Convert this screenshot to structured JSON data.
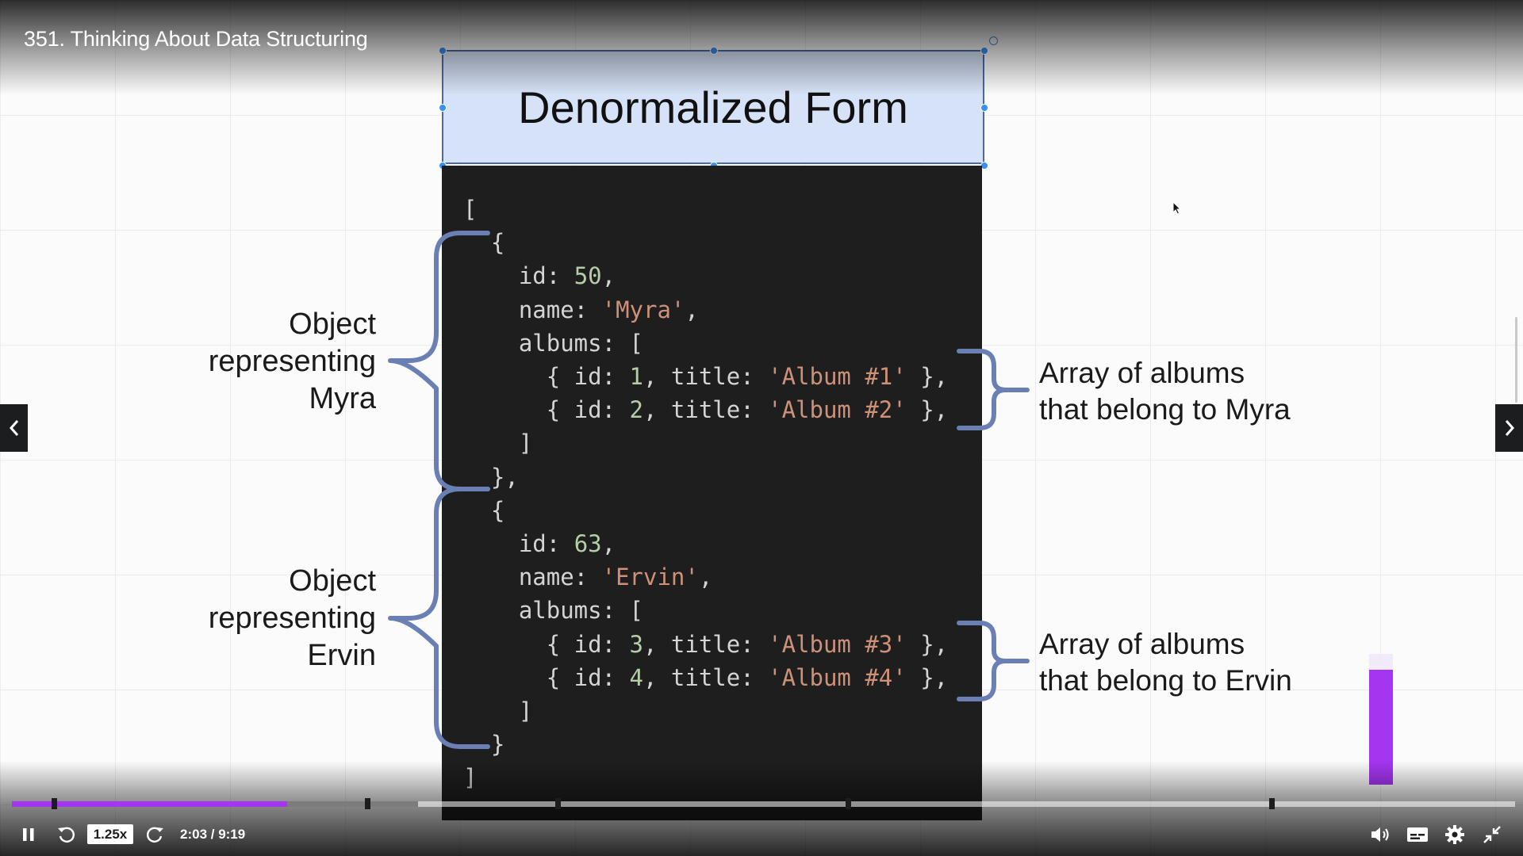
{
  "player": {
    "lecture_title": "351. Thinking About Data Structuring",
    "speed": "1.25x",
    "time": "2:03 / 9:19",
    "progress": {
      "played_fraction": 0.183,
      "buffered_fraction": 0.27
    },
    "accent_color": "#a435f0",
    "icons": [
      "pause-icon",
      "rewind-icon",
      "forward-icon",
      "volume-icon",
      "captions-icon",
      "settings-icon",
      "exit-fullscreen-icon",
      "chevron-left-icon",
      "chevron-right-icon"
    ]
  },
  "slide": {
    "title": "Denormalized Form",
    "code_lines": [
      "[",
      "  {",
      "    id: 50,",
      "    name: 'Myra',",
      "    albums: [",
      "      { id: 1, title: 'Album #1' },",
      "      { id: 2, title: 'Album #2' },",
      "    ]",
      "  },",
      "  {",
      "    id: 63,",
      "    name: 'Ervin',",
      "    albums: [",
      "      { id: 3, title: 'Album #3' },",
      "      { id: 4, title: 'Album #4' },",
      "    ]",
      "  }",
      "]"
    ],
    "annotations": {
      "myra_object": [
        "Object",
        "representing",
        "Myra"
      ],
      "ervin_object": [
        "Object",
        "representing",
        "Ervin"
      ],
      "myra_albums": [
        "Array of albums",
        "that belong to Myra"
      ],
      "ervin_albums": [
        "Array of albums",
        "that belong to Ervin"
      ]
    },
    "colors": {
      "title_box": "#d6e2f7",
      "code_background": "#1e1e1e",
      "brace": "#6a7fb3",
      "code_number": "#b5cea8",
      "code_string": "#ce9178"
    }
  }
}
